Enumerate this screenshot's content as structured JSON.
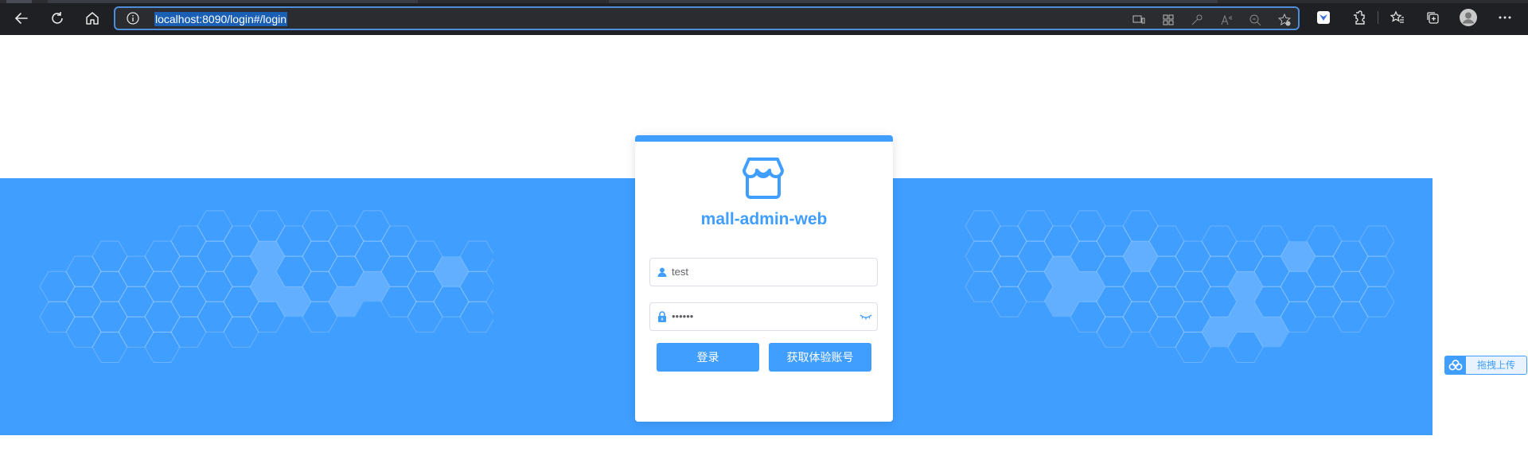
{
  "browser": {
    "url": "localhost:8090/login#/login",
    "nav_icons": [
      "back-icon",
      "refresh-icon",
      "home-icon"
    ],
    "omnibox_icons": [
      "device-icon",
      "apps-icon",
      "key-icon",
      "read-aloud-icon",
      "zoom-out-icon",
      "add-favorite-icon"
    ],
    "toolbar_icons": [
      "extension-blue-icon",
      "extensions-icon",
      "favorites-icon",
      "collections-icon",
      "profile-avatar",
      "more-icon"
    ]
  },
  "login": {
    "title": "mall-admin-web",
    "username_value": "test",
    "password_value": "••••••",
    "login_button": "登录",
    "trial_button": "获取体验账号"
  },
  "floating": {
    "upload_label": "拖拽上传"
  },
  "colors": {
    "brand_blue": "#409eff",
    "chrome_bg": "#1f2023"
  }
}
